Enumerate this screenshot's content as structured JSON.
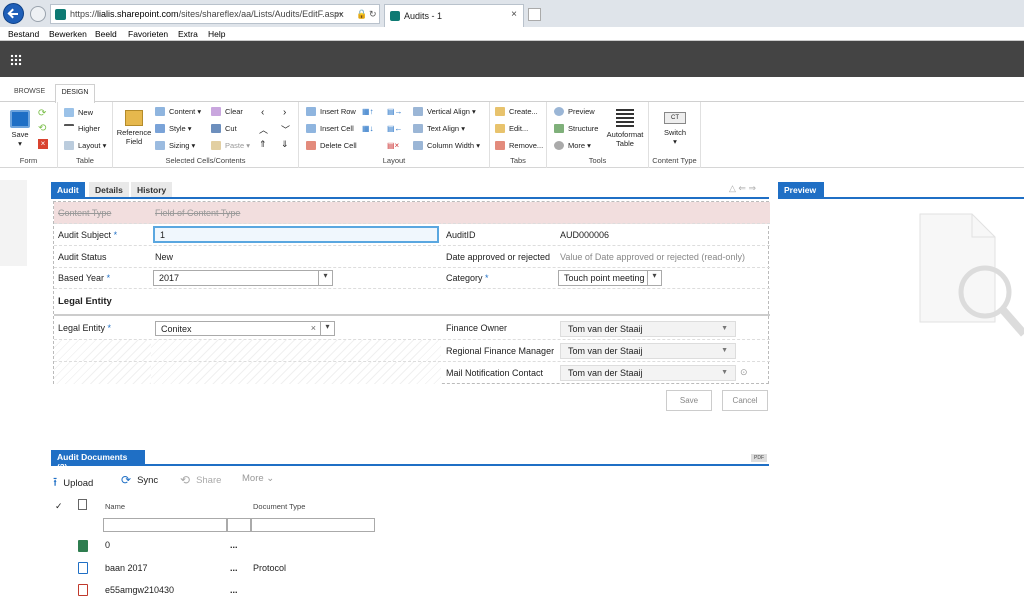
{
  "browser": {
    "url_prefix": "https://",
    "url_host": "lialis.sharepoint.com",
    "url_path": "/sites/shareflex/aa/Lists/Audits/EditF.aspx",
    "tab_title": "Audits - 1",
    "menu": [
      "Bestand",
      "Bewerken",
      "Beeld",
      "Favorieten",
      "Extra",
      "Help"
    ]
  },
  "ribbon": {
    "tabs": {
      "browse": "BROWSE",
      "design": "DESIGN"
    },
    "groups": {
      "form": {
        "label": "Form",
        "save": "Save"
      },
      "table": {
        "label": "Table",
        "new": "New",
        "higher": "Higher",
        "layout": "Layout"
      },
      "cells": {
        "label": "Selected Cells/Contents",
        "reference_field": "Reference Field",
        "content": "Content",
        "style": "Style",
        "sizing": "Sizing",
        "clear": "Clear",
        "cut": "Cut",
        "paste": "Paste"
      },
      "layout": {
        "label": "Layout",
        "insert_row": "Insert Row",
        "insert_cell": "Insert Cell",
        "delete_cell": "Delete Cell",
        "vertical_align": "Vertical Align",
        "text_align": "Text Align",
        "column_width": "Column Width"
      },
      "tabs": {
        "label": "Tabs",
        "create": "Create...",
        "edit": "Edit...",
        "remove": "Remove..."
      },
      "tools": {
        "label": "Tools",
        "preview": "Preview",
        "structure": "Structure",
        "more": "More",
        "autoformat": "Autoformat Table"
      },
      "content_type": {
        "label": "Content Type",
        "switch": "Switch",
        "ct": "CT"
      }
    }
  },
  "form": {
    "tabs": [
      "Audit",
      "Details",
      "History"
    ],
    "preview_label": "Preview",
    "header": {
      "content_type": "Content Type",
      "field": "Field of Content Type"
    },
    "fields": {
      "audit_subject": {
        "label": "Audit Subject",
        "value": "1"
      },
      "audit_status": {
        "label": "Audit Status",
        "value": "New"
      },
      "based_year": {
        "label": "Based Year",
        "value": "2017"
      },
      "legal_entity_heading": "Legal Entity",
      "legal_entity": {
        "label": "Legal Entity",
        "value": "Conitex"
      },
      "audit_id": {
        "label": "AuditID",
        "value": "AUD000006"
      },
      "date_approved": {
        "label": "Date approved or rejected",
        "placeholder": "Value of Date approved or rejected (read-only)"
      },
      "category": {
        "label": "Category",
        "value": "Touch point meeting"
      },
      "finance_owner": {
        "label": "Finance Owner",
        "value": "Tom van der Staaij"
      },
      "regional_fm": {
        "label": "Regional Finance Manager",
        "value": "Tom van der Staaij"
      },
      "mail_contact": {
        "label": "Mail Notification Contact",
        "value": "Tom van der Staaij"
      }
    },
    "required_marker": "*",
    "save": "Save",
    "cancel": "Cancel"
  },
  "documents": {
    "title": "Audit Documents (3)",
    "badge": "PDF",
    "commands": {
      "upload": "Upload",
      "sync": "Sync",
      "share": "Share",
      "more": "More"
    },
    "columns": {
      "name": "Name",
      "type": "Document Type"
    },
    "rows": [
      {
        "name": "0",
        "type": ""
      },
      {
        "name": "baan 2017",
        "type": "Protocol"
      },
      {
        "name": "e55amgw210430",
        "type": ""
      }
    ],
    "ellipsis": "..."
  }
}
